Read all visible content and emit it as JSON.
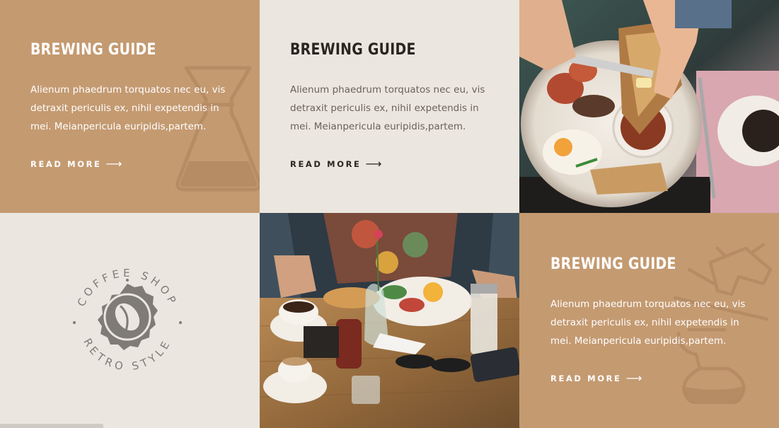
{
  "cards": [
    {
      "title": "BREWING GUIDE",
      "text": "Alienum phaedrum torquatos nec eu, vis detraxit periculis ex, nihil expetendis in mei. Meianpericula euripidis,partem.",
      "link": "READ MORE",
      "icon": "chemex-icon"
    },
    {
      "title": "BREWING GUIDE",
      "text": "Alienum phaedrum torquatos nec eu, vis detraxit periculis ex, nihil expetendis in mei. Meianpericula euripidis,partem.",
      "link": "READ MORE"
    },
    {
      "title": "BREWING GUIDE",
      "text": "Alienum phaedrum torquatos nec eu, vis detraxit periculis ex, nihil expetendis in mei. Meianpericula euripidis,partem.",
      "link": "READ MORE",
      "icon": "kettle-icon"
    }
  ],
  "logo": {
    "top_text": "COFFEE SHOP",
    "bottom_text": "RETRO STYLE"
  },
  "colors": {
    "tan": "#c49a71",
    "cream": "#ebe6df",
    "dark": "#2b2520"
  }
}
